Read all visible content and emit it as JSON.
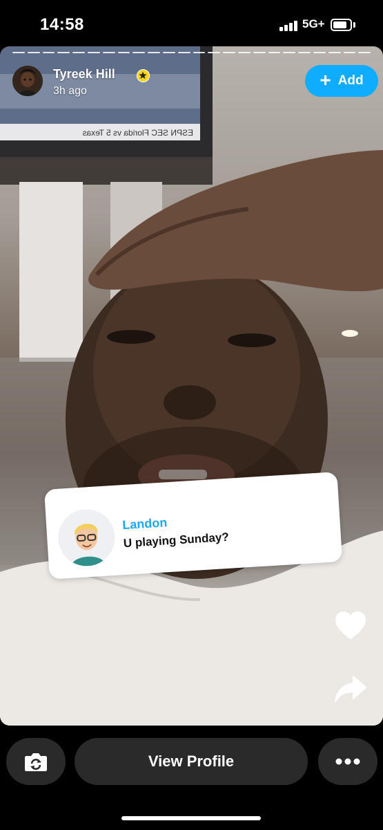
{
  "status_bar": {
    "time": "14:58",
    "network": "5G+",
    "signal_bars": 4,
    "battery_icon": "battery-icon"
  },
  "story": {
    "poster_name": "Tyreek Hill",
    "posted_ago": "3h ago",
    "badge_icon": "star-badge-icon",
    "add_button_label": "Add",
    "add_icon": "plus-icon",
    "tv_ticker": [
      "ESPN",
      "SEC",
      "Florida vs 5 Texas"
    ]
  },
  "reply": {
    "name": "Landon",
    "text": "U playing Sunday?",
    "name_color": "#1fa8f0"
  },
  "side_actions": {
    "like_icon": "heart-icon",
    "share_icon": "share-arrow-icon"
  },
  "bottom_bar": {
    "camera_icon": "camera-flip-icon",
    "view_profile_label": "View Profile",
    "more_icon": "more-dots-icon"
  },
  "colors": {
    "accent": "#0fadff",
    "badge": "#f7d51d",
    "button_bg": "#2a2a2a"
  }
}
